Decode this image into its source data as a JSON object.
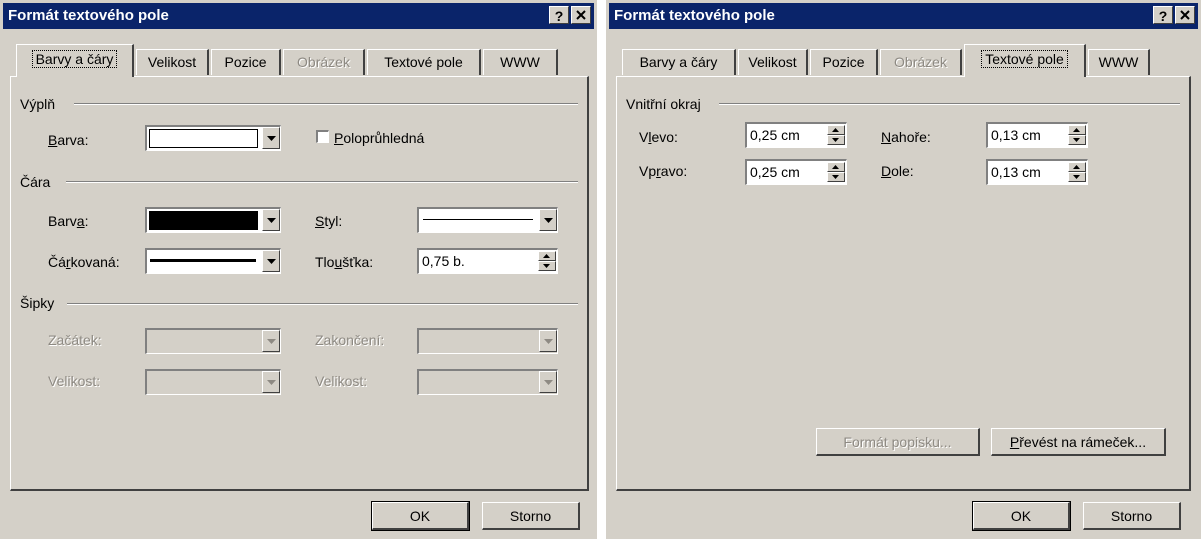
{
  "dialog1": {
    "title": "Formát textového pole",
    "tabs": [
      "Barvy a čáry",
      "Velikost",
      "Pozice",
      "Obrázek",
      "Textové pole",
      "WWW"
    ],
    "fill": {
      "group": "Výplň",
      "color_label": "Barva:",
      "color_value": "#ffffff",
      "semi_transparent_label": "Poloprůhledná",
      "semi_transparent_checked": false
    },
    "line": {
      "group": "Čára",
      "color_label": "Barva:",
      "color_value": "#000000",
      "style_label": "Styl:",
      "dashed_label": "Čárkovaná:",
      "weight_label": "Tloušťka:",
      "weight_value": "0,75 b."
    },
    "arrows": {
      "group": "Šipky",
      "begin_style_label": "Začátek:",
      "end_style_label": "Zakončení:",
      "begin_size_label": "Velikost:",
      "end_size_label": "Velikost:"
    },
    "ok": "OK",
    "cancel": "Storno"
  },
  "dialog2": {
    "title": "Formát textového pole",
    "tabs": [
      "Barvy a čáry",
      "Velikost",
      "Pozice",
      "Obrázek",
      "Textové pole",
      "WWW"
    ],
    "margins": {
      "group": "Vnitřní okraj",
      "left_label": "Vlevo:",
      "left_value": "0,25 cm",
      "right_label": "Vpravo:",
      "right_value": "0,25 cm",
      "top_label": "Nahoře:",
      "top_value": "0,13 cm",
      "bottom_label": "Dole:",
      "bottom_value": "0,13 cm"
    },
    "format_callout": "Formát popisku...",
    "convert_to_frame": "Převést na rámeček...",
    "ok": "OK",
    "cancel": "Storno"
  },
  "colors": {
    "title_bar": "#0a246a",
    "face": "#d4d0c8",
    "disabled_text": "#8e8a83"
  }
}
